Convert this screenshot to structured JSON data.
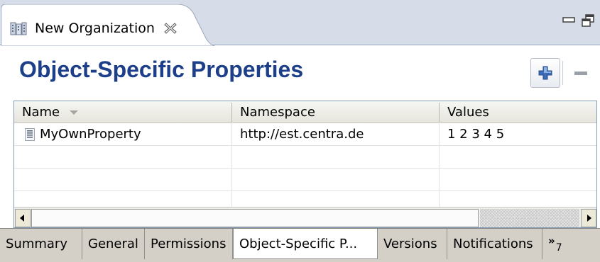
{
  "editor_tab": {
    "title": "New Organization",
    "icon": "organization-icon",
    "close_icon": "close-icon"
  },
  "window_controls": {
    "minimize_icon": "minimize-icon",
    "restore_icon": "restore-icon"
  },
  "form": {
    "title": "Object-Specific Properties",
    "add_icon": "add-icon",
    "remove_icon": "remove-icon",
    "accent_color": "#1d3f8a"
  },
  "table": {
    "columns": [
      "Name",
      "Namespace",
      "Values"
    ],
    "sort_icon": "sort-descending-icon",
    "rows": [
      {
        "name": "MyOwnProperty",
        "namespace": "http://est.centra.de",
        "values": "1 2 3 4 5",
        "icon": "property-icon"
      }
    ]
  },
  "bottom_tabs": {
    "items": [
      "Summary",
      "General",
      "Permissions",
      "Object-Specific P...",
      "Versions",
      "Notifications"
    ],
    "active": "Object-Specific P...",
    "overflow_symbol": "»",
    "overflow_count": "7"
  }
}
